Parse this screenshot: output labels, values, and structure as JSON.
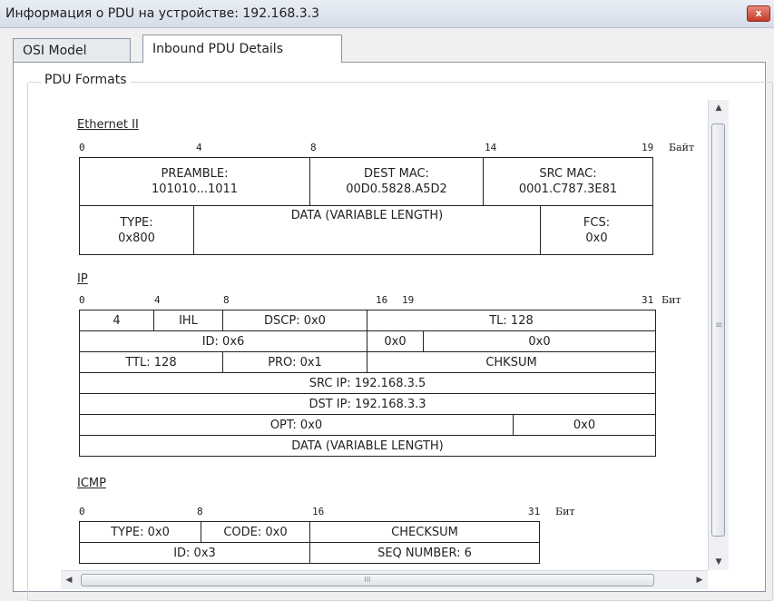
{
  "window": {
    "title": "Информация о PDU на устройстве: 192.168.3.3",
    "close_glyph": "x"
  },
  "tabs": [
    {
      "label": "OSI Model"
    },
    {
      "label": "Inbound PDU Details"
    }
  ],
  "groupbox": {
    "label": "PDU Formats"
  },
  "ethernet": {
    "title": "Ethernet II",
    "ruler": [
      "0",
      "4",
      "8",
      "14",
      "19"
    ],
    "unit": "Байт",
    "preamble": {
      "name": "PREAMBLE:",
      "value": "101010...1011"
    },
    "dest_mac": {
      "name": "DEST MAC:",
      "value": "00D0.5828.A5D2"
    },
    "src_mac": {
      "name": "SRC MAC:",
      "value": "0001.C787.3E81"
    },
    "type": {
      "name": "TYPE:",
      "value": "0x800"
    },
    "data": "DATA (VARIABLE LENGTH)",
    "fcs": {
      "name": "FCS:",
      "value": "0x0"
    }
  },
  "ip": {
    "title": "IP",
    "ruler": [
      "0",
      "4",
      "8",
      "16",
      "19",
      "31"
    ],
    "unit": "Бит",
    "version": "4",
    "ihl": "IHL",
    "dscp": "DSCP: 0x0",
    "tl": "TL: 128",
    "id": "ID: 0x6",
    "flags": "0x0",
    "frag": "0x0",
    "ttl": "TTL: 128",
    "pro": "PRO: 0x1",
    "chksum": "CHKSUM",
    "src_ip": "SRC IP: 192.168.3.5",
    "dst_ip": "DST IP: 192.168.3.3",
    "opt": "OPT: 0x0",
    "padding": "0x0",
    "data": "DATA (VARIABLE LENGTH)"
  },
  "icmp": {
    "title": "ICMP",
    "ruler": [
      "0",
      "8",
      "16",
      "31"
    ],
    "unit": "Бит",
    "type": "TYPE: 0x0",
    "code": "CODE: 0x0",
    "checksum": "CHECKSUM",
    "id": "ID: 0x3",
    "seq": "SEQ NUMBER: 6"
  },
  "scrollbars": {
    "up": "▲",
    "down": "▼",
    "left": "◀",
    "right": "▶",
    "h_grip": "III",
    "v_grip": "≡"
  }
}
